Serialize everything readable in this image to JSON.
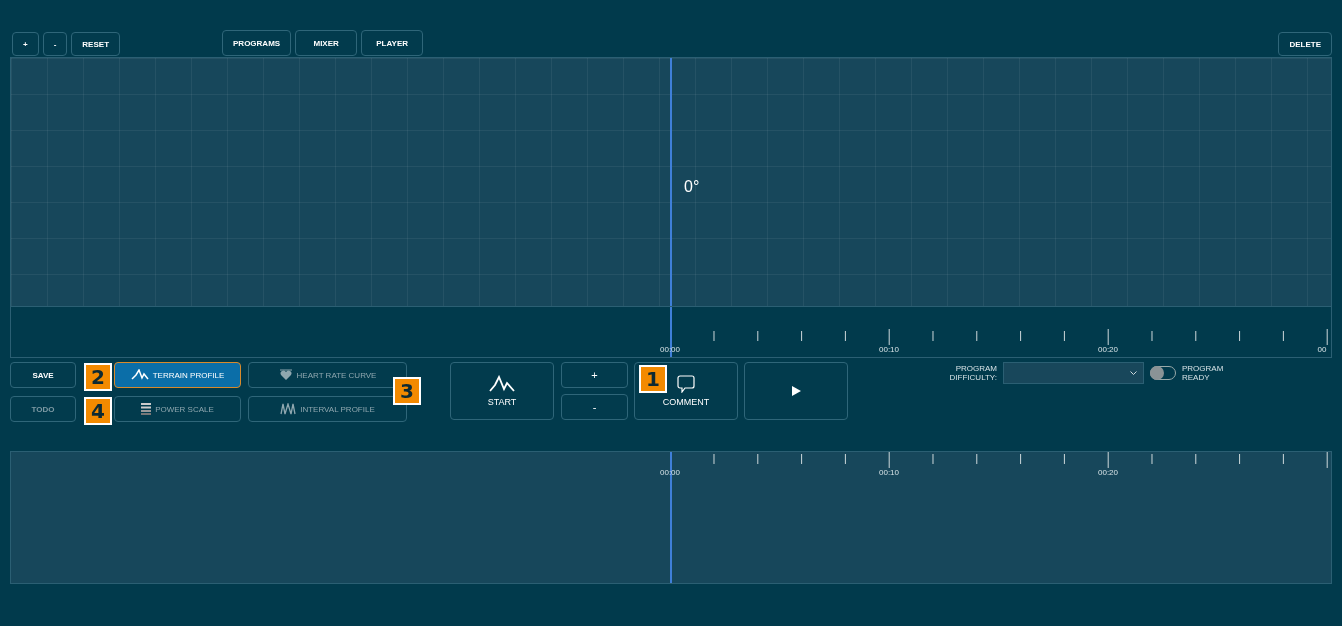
{
  "toolbar": {
    "zoom_buttons": [
      {
        "label": "+"
      },
      {
        "label": "-"
      },
      {
        "label": "RESET"
      }
    ],
    "view_tabs": [
      {
        "label": "PROGRAMS"
      },
      {
        "label": "MIXER"
      },
      {
        "label": "PLAYER"
      }
    ],
    "delete_button": "DELETE"
  },
  "chart": {
    "angle_label": "0°"
  },
  "top_timeline": {
    "labels": [
      "00:00",
      "00:10",
      "00:20",
      "00"
    ]
  },
  "actions": [
    {
      "label": "SAVE",
      "disabled": false
    },
    {
      "label": "TODO",
      "disabled": true
    }
  ],
  "profiles": [
    {
      "label": "TERRAIN PROFILE",
      "kind": "terrain",
      "selected": true
    },
    {
      "label": "HEART RATE CURVE",
      "kind": "heart",
      "selected": false
    },
    {
      "label": "POWER SCALE",
      "kind": "bars",
      "selected": false
    },
    {
      "label": "INTERVAL PROFILE",
      "kind": "wave",
      "selected": false
    }
  ],
  "start_button": "START",
  "step_buttons": [
    "+",
    "-"
  ],
  "comment_button": "COMMENT",
  "difficulty": {
    "label": "PROGRAM DIFFICULTY:"
  },
  "ready_toggle": {
    "label": "PROGRAM READY",
    "on": false
  },
  "bottom_timeline": {
    "labels": [
      "00:00",
      "00:10",
      "00:20"
    ]
  },
  "badges": [
    {
      "text": "2"
    },
    {
      "text": "4"
    },
    {
      "text": "3"
    },
    {
      "text": "1"
    }
  ]
}
